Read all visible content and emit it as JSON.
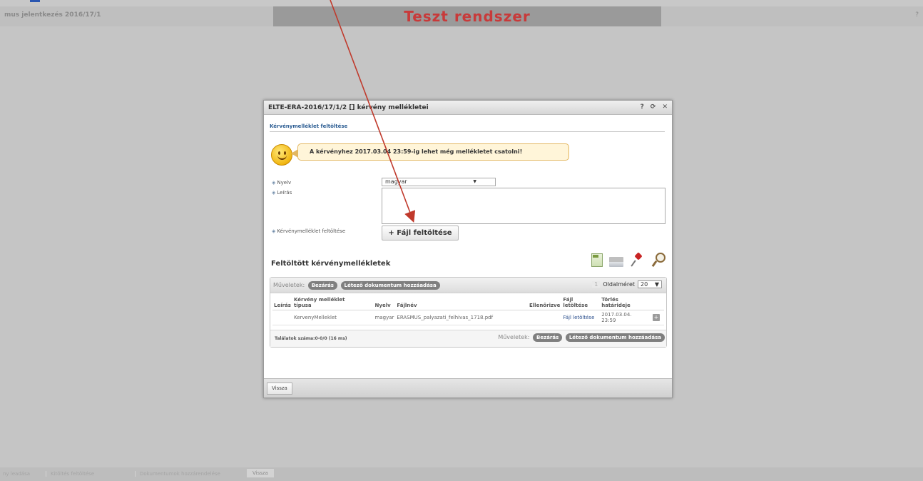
{
  "header": {
    "left_title": "mus jelentkezés 2016/17/1",
    "banner": "Teszt rendszer",
    "right_mark": "?"
  },
  "bottom_bar": {
    "items": [
      "ny leadása",
      "Kitöltés feltöltése",
      "Dokumentumok hozzárendelése",
      "Vissza"
    ]
  },
  "dialog": {
    "title": "ELTE-ERA-2016/17/1/2 [] kérvény mellékletei",
    "controls": [
      "?",
      "⟳",
      "✕"
    ],
    "section_title": "Kérvénymelléklet feltöltése",
    "notice": "A kérvényhez 2017.03.04 23:59-ig lehet még mellékletet csatolni!",
    "form": {
      "language_label": "Nyelv",
      "language_value": "magyar",
      "description_label": "Leírás",
      "upload_label": "Kérvénymelléklet feltöltése",
      "upload_button": "Fájl feltöltése"
    },
    "list_heading": "Feltöltött kérvénymellékletek",
    "tool_icons": [
      "excel-export-icon",
      "print-icon",
      "pin-icon",
      "search-icon"
    ],
    "grid": {
      "toolbar_label": "Műveletek:",
      "close_button": "Bezárás",
      "add_existing_button": "Létező dokumentum hozzáadása",
      "page_number": "1",
      "page_size_label": "Oldalméret",
      "page_size_value": "20",
      "columns": {
        "description": "Leírás",
        "type_line1": "Kérvény melléklet",
        "type_line2": "típusa",
        "language": "Nyelv",
        "filename": "Fájlnév",
        "checked": "Ellenőrizve",
        "download_line1": "Fájl",
        "download_line2": "letöltése",
        "deadline_line1": "Törlés",
        "deadline_line2": "határideje"
      },
      "rows": [
        {
          "description": "",
          "type": "KervenyMelleklet",
          "language": "magyar",
          "filename": "ERASMUS_palyazati_felhivas_1718.pdf",
          "checked": "",
          "download": "Fájl letöltése",
          "deadline_line1": "2017.03.04.",
          "deadline_line2": "23:59"
        }
      ],
      "result_count": "Találatok száma:0-0/0 (16 ms)",
      "footer_label": "Műveletek:",
      "footer_close_button": "Bezárás",
      "footer_add_existing_button": "Létező dokumentum hozzáadása"
    },
    "back_button": "Vissza"
  },
  "colors": {
    "banner_text": "#c83a3a",
    "annotation_arrow": "#c0392b",
    "link": "#2b4f8d"
  }
}
